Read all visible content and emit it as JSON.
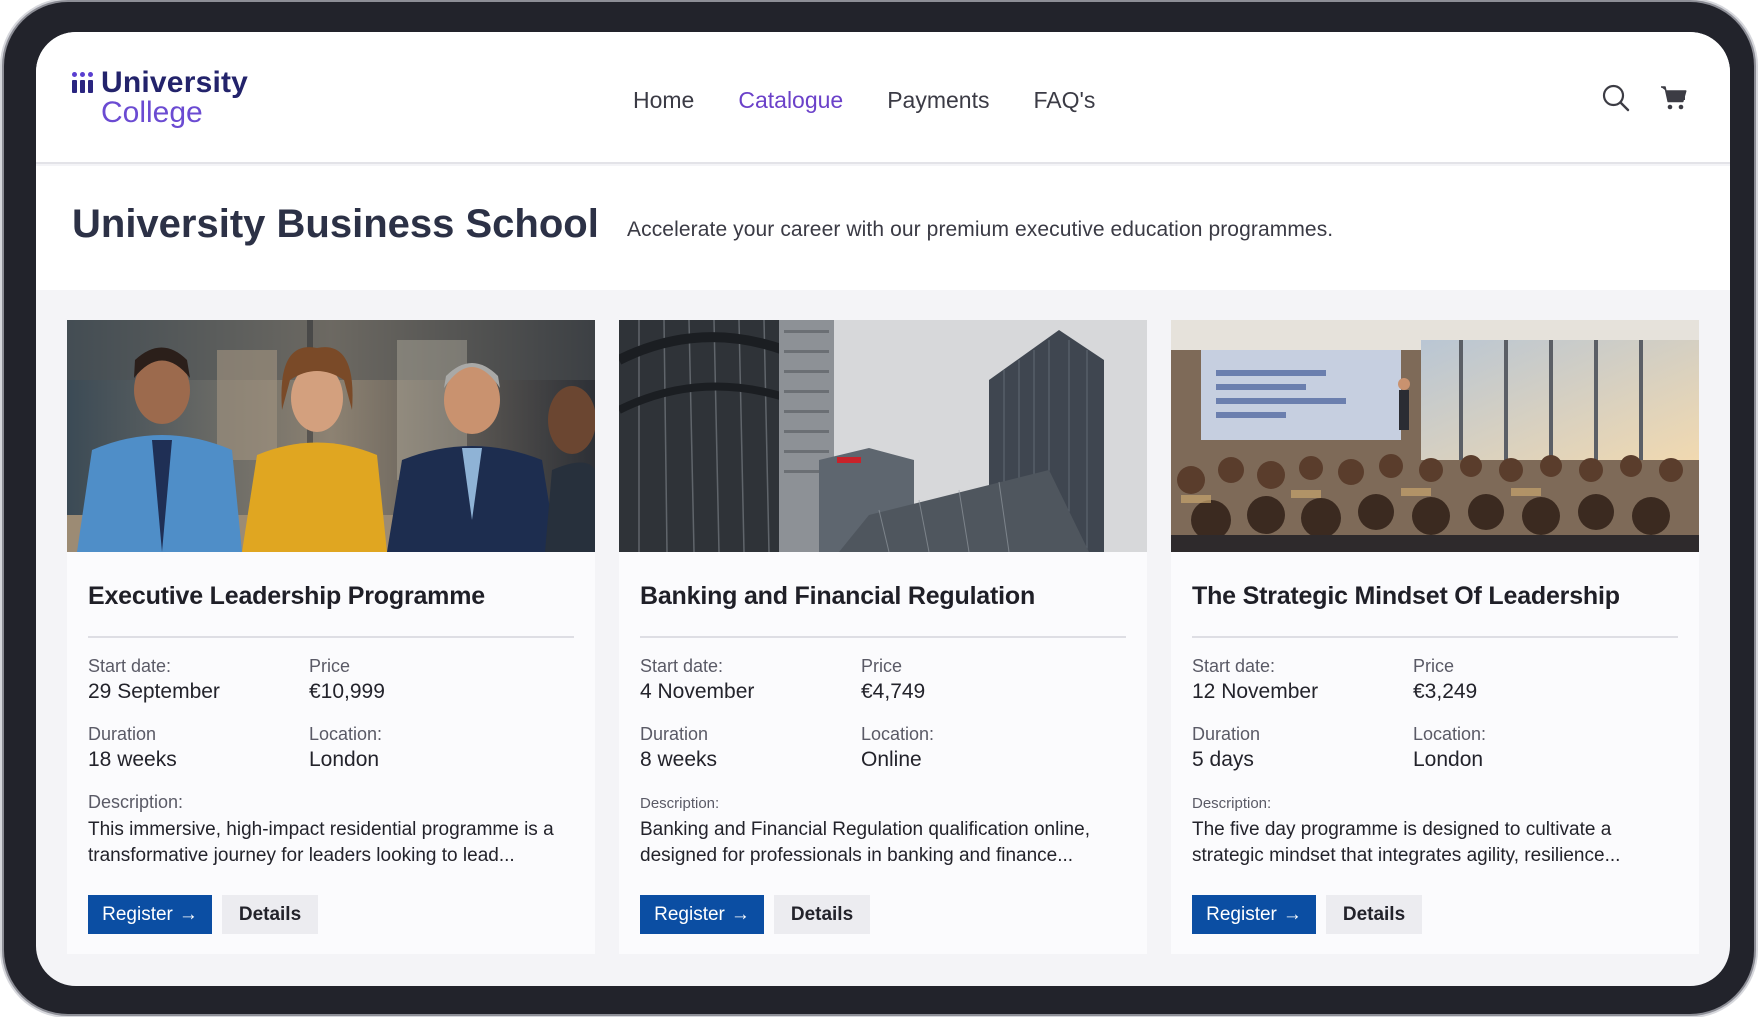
{
  "logo": {
    "line1": "University",
    "line2": "College"
  },
  "nav": {
    "items": [
      {
        "label": "Home",
        "active": false
      },
      {
        "label": "Catalogue",
        "active": true
      },
      {
        "label": "Payments",
        "active": false
      },
      {
        "label": "FAQ's",
        "active": false
      }
    ]
  },
  "header_icons": [
    "search-icon",
    "cart-icon"
  ],
  "hero": {
    "title": "University Business School",
    "subtitle": "Accelerate your career with our premium executive education programmes."
  },
  "labels": {
    "start_date": "Start date:",
    "price": "Price",
    "duration": "Duration",
    "location": "Location:",
    "description": "Description:",
    "register": "Register",
    "register_arrow": "→",
    "details": "Details"
  },
  "cards": [
    {
      "image": "business-meeting-photo",
      "title": "Executive Leadership Programme",
      "start_date": "29 September",
      "price": "€10,999",
      "duration": "18 weeks",
      "location": "London",
      "description": "This immersive, high-impact residential programme is a transformative journey for leaders looking to lead..."
    },
    {
      "image": "financial-district-skyscrapers-photo",
      "title": "Banking and Financial Regulation",
      "start_date": "4 November",
      "price": "€4,749",
      "duration": "8 weeks",
      "location": "Online",
      "description": "Banking and Financial Regulation qualification online, designed for professionals in banking and finance..."
    },
    {
      "image": "conference-audience-photo",
      "title": "The Strategic Mindset Of Leadership",
      "start_date": "12 November",
      "price": "€3,249",
      "duration": "5 days",
      "location": "London",
      "description": "The five day programme is designed to cultivate a strategic mindset that integrates agility, resilience..."
    }
  ],
  "colors": {
    "brand_navy": "#23236b",
    "brand_purple": "#6b4bd2",
    "nav_active": "#6b41c9",
    "register_button": "#0b4ea3",
    "details_button": "#ececf0"
  }
}
